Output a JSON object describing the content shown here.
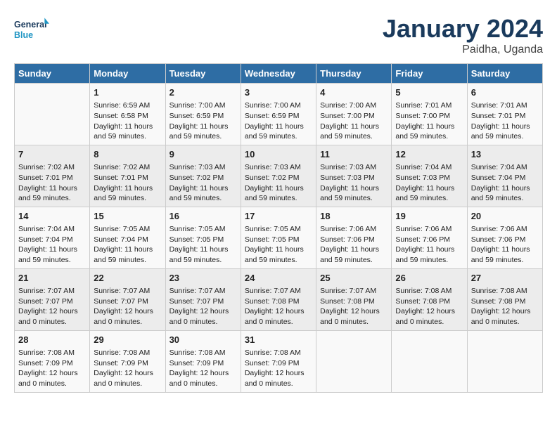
{
  "header": {
    "logo_general": "General",
    "logo_blue": "Blue",
    "month": "January 2024",
    "location": "Paidha, Uganda"
  },
  "days_of_week": [
    "Sunday",
    "Monday",
    "Tuesday",
    "Wednesday",
    "Thursday",
    "Friday",
    "Saturday"
  ],
  "weeks": [
    [
      {
        "day": "",
        "info": ""
      },
      {
        "day": "1",
        "info": "Sunrise: 6:59 AM\nSunset: 6:58 PM\nDaylight: 11 hours\nand 59 minutes."
      },
      {
        "day": "2",
        "info": "Sunrise: 7:00 AM\nSunset: 6:59 PM\nDaylight: 11 hours\nand 59 minutes."
      },
      {
        "day": "3",
        "info": "Sunrise: 7:00 AM\nSunset: 6:59 PM\nDaylight: 11 hours\nand 59 minutes."
      },
      {
        "day": "4",
        "info": "Sunrise: 7:00 AM\nSunset: 7:00 PM\nDaylight: 11 hours\nand 59 minutes."
      },
      {
        "day": "5",
        "info": "Sunrise: 7:01 AM\nSunset: 7:00 PM\nDaylight: 11 hours\nand 59 minutes."
      },
      {
        "day": "6",
        "info": "Sunrise: 7:01 AM\nSunset: 7:01 PM\nDaylight: 11 hours\nand 59 minutes."
      }
    ],
    [
      {
        "day": "7",
        "info": "Sunrise: 7:02 AM\nSunset: 7:01 PM\nDaylight: 11 hours\nand 59 minutes."
      },
      {
        "day": "8",
        "info": "Sunrise: 7:02 AM\nSunset: 7:01 PM\nDaylight: 11 hours\nand 59 minutes."
      },
      {
        "day": "9",
        "info": "Sunrise: 7:03 AM\nSunset: 7:02 PM\nDaylight: 11 hours\nand 59 minutes."
      },
      {
        "day": "10",
        "info": "Sunrise: 7:03 AM\nSunset: 7:02 PM\nDaylight: 11 hours\nand 59 minutes."
      },
      {
        "day": "11",
        "info": "Sunrise: 7:03 AM\nSunset: 7:03 PM\nDaylight: 11 hours\nand 59 minutes."
      },
      {
        "day": "12",
        "info": "Sunrise: 7:04 AM\nSunset: 7:03 PM\nDaylight: 11 hours\nand 59 minutes."
      },
      {
        "day": "13",
        "info": "Sunrise: 7:04 AM\nSunset: 7:04 PM\nDaylight: 11 hours\nand 59 minutes."
      }
    ],
    [
      {
        "day": "14",
        "info": "Sunrise: 7:04 AM\nSunset: 7:04 PM\nDaylight: 11 hours\nand 59 minutes."
      },
      {
        "day": "15",
        "info": "Sunrise: 7:05 AM\nSunset: 7:04 PM\nDaylight: 11 hours\nand 59 minutes."
      },
      {
        "day": "16",
        "info": "Sunrise: 7:05 AM\nSunset: 7:05 PM\nDaylight: 11 hours\nand 59 minutes."
      },
      {
        "day": "17",
        "info": "Sunrise: 7:05 AM\nSunset: 7:05 PM\nDaylight: 11 hours\nand 59 minutes."
      },
      {
        "day": "18",
        "info": "Sunrise: 7:06 AM\nSunset: 7:06 PM\nDaylight: 11 hours\nand 59 minutes."
      },
      {
        "day": "19",
        "info": "Sunrise: 7:06 AM\nSunset: 7:06 PM\nDaylight: 11 hours\nand 59 minutes."
      },
      {
        "day": "20",
        "info": "Sunrise: 7:06 AM\nSunset: 7:06 PM\nDaylight: 11 hours\nand 59 minutes."
      }
    ],
    [
      {
        "day": "21",
        "info": "Sunrise: 7:07 AM\nSunset: 7:07 PM\nDaylight: 12 hours\nand 0 minutes."
      },
      {
        "day": "22",
        "info": "Sunrise: 7:07 AM\nSunset: 7:07 PM\nDaylight: 12 hours\nand 0 minutes."
      },
      {
        "day": "23",
        "info": "Sunrise: 7:07 AM\nSunset: 7:07 PM\nDaylight: 12 hours\nand 0 minutes."
      },
      {
        "day": "24",
        "info": "Sunrise: 7:07 AM\nSunset: 7:08 PM\nDaylight: 12 hours\nand 0 minutes."
      },
      {
        "day": "25",
        "info": "Sunrise: 7:07 AM\nSunset: 7:08 PM\nDaylight: 12 hours\nand 0 minutes."
      },
      {
        "day": "26",
        "info": "Sunrise: 7:08 AM\nSunset: 7:08 PM\nDaylight: 12 hours\nand 0 minutes."
      },
      {
        "day": "27",
        "info": "Sunrise: 7:08 AM\nSunset: 7:08 PM\nDaylight: 12 hours\nand 0 minutes."
      }
    ],
    [
      {
        "day": "28",
        "info": "Sunrise: 7:08 AM\nSunset: 7:09 PM\nDaylight: 12 hours\nand 0 minutes."
      },
      {
        "day": "29",
        "info": "Sunrise: 7:08 AM\nSunset: 7:09 PM\nDaylight: 12 hours\nand 0 minutes."
      },
      {
        "day": "30",
        "info": "Sunrise: 7:08 AM\nSunset: 7:09 PM\nDaylight: 12 hours\nand 0 minutes."
      },
      {
        "day": "31",
        "info": "Sunrise: 7:08 AM\nSunset: 7:09 PM\nDaylight: 12 hours\nand 0 minutes."
      },
      {
        "day": "",
        "info": ""
      },
      {
        "day": "",
        "info": ""
      },
      {
        "day": "",
        "info": ""
      }
    ]
  ]
}
